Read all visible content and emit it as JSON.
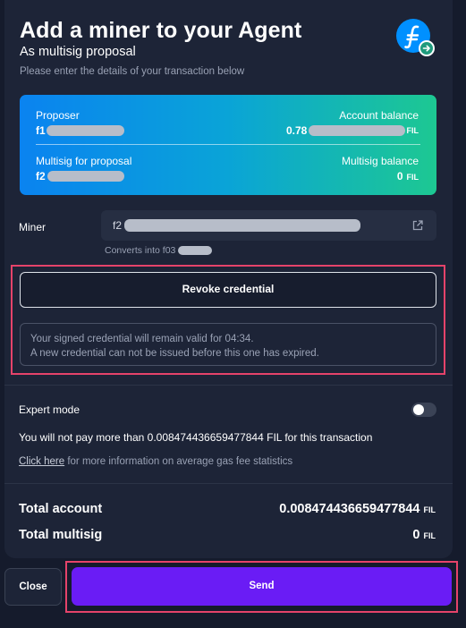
{
  "header": {
    "title": "Add a miner to your Agent",
    "subtitle": "As multisig proposal",
    "hint": "Please enter the details of your transaction below"
  },
  "logo": {
    "icon": "filecoin-icon",
    "badge_icon": "arrow-right-icon",
    "brand_color": "#0090ff",
    "badge_color": "#1f9b7d"
  },
  "summary_card": {
    "proposer_label": "Proposer",
    "proposer_value": "f1",
    "account_balance_label": "Account balance",
    "account_balance_value": "0.78",
    "account_balance_unit": "FIL",
    "multisig_label": "Multisig for proposal",
    "multisig_value": "f2",
    "multisig_balance_label": "Multisig balance",
    "multisig_balance_value": "0",
    "multisig_balance_unit": "FIL",
    "gradient_colors": [
      "#0a83f0",
      "#1dc892"
    ]
  },
  "miner": {
    "label": "Miner",
    "value_prefix": "f2",
    "converts_prefix": "Converts into f03"
  },
  "credential": {
    "revoke_label": "Revoke credential",
    "notice_line1": "Your signed credential will remain valid for 04:34.",
    "notice_line2": "A new credential can not be issued before this one has expired."
  },
  "expert": {
    "label": "Expert mode",
    "enabled": false
  },
  "fee": {
    "text": "You will not pay more than 0.008474436659477844 FIL for this transaction",
    "link_text": "Click here",
    "link_suffix": " for more information on average gas fee statistics"
  },
  "totals": {
    "account_label": "Total account",
    "account_value": "0.008474436659477844",
    "account_unit": "FIL",
    "multisig_label": "Total multisig",
    "multisig_value": "0",
    "multisig_unit": "FIL"
  },
  "footer": {
    "close_label": "Close",
    "send_label": "Send",
    "send_color": "#6a1cf5",
    "highlight_color": "#e5436a"
  }
}
